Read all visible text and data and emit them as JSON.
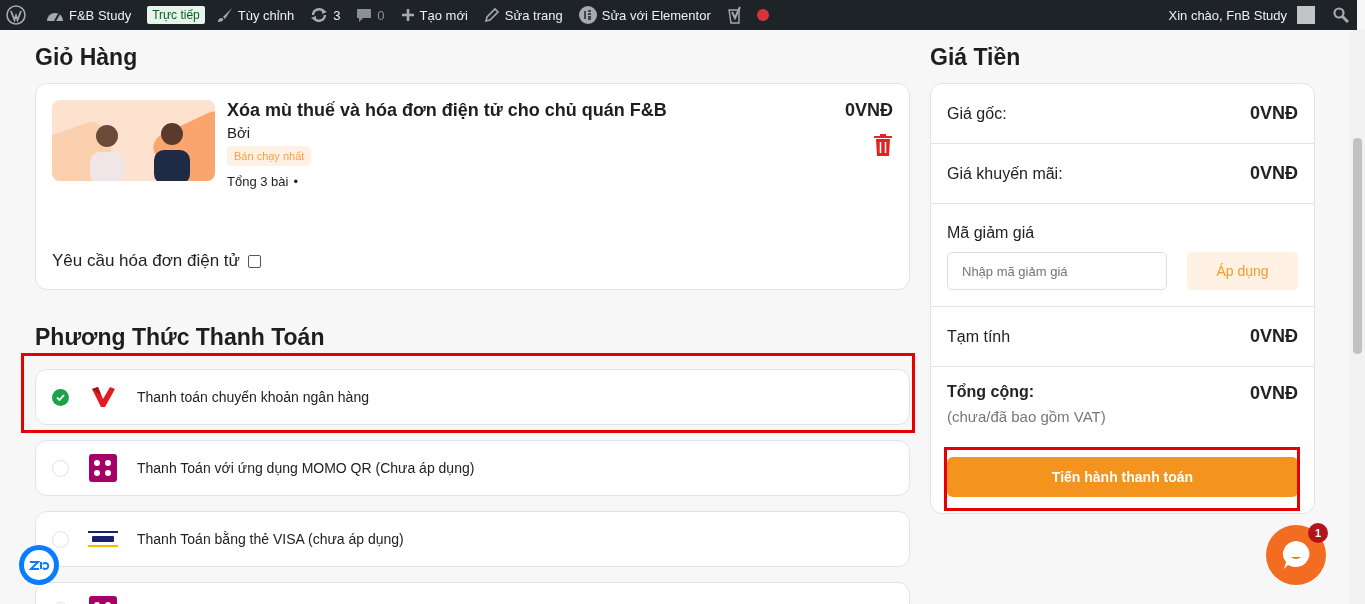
{
  "admin_bar": {
    "site": "F&B Study",
    "live_badge": "Trực tiếp",
    "customize": "Tùy chỉnh",
    "updates": "3",
    "comments": "0",
    "new": "Tạo mới",
    "edit_page": "Sửa trang",
    "elementor": "Sửa với Elementor",
    "greeting": "Xin chào, FnB Study"
  },
  "cart": {
    "title": "Giỏ Hàng",
    "items": [
      {
        "kind": "picture",
        "name": "Xóa mù thuế và hóa đơn điện tử cho chủ quán F&B",
        "by": "Bởi",
        "tag": "Bán chạy nhất",
        "lessons": "Tổng 3 bài",
        "bullet": "•",
        "price": "0VNĐ"
      }
    ],
    "invoice_label": "Yêu cầu hóa đơn điện tử",
    "invoice_checked": false
  },
  "payment": {
    "title": "Phương Thức Thanh Toán",
    "methods": [
      {
        "kind": "bank",
        "label": "Thanh toán chuyển khoản ngân hàng",
        "selected": true,
        "highlighted": true
      },
      {
        "kind": "momo",
        "label": "Thanh Toán với ứng dụng MOMO QR (Chưa áp dụng)",
        "selected": false,
        "highlighted": false
      },
      {
        "kind": "visa",
        "label": "Thanh Toán bằng thẻ VISA (chưa áp dụng)",
        "selected": false,
        "highlighted": false
      },
      {
        "kind": "momo",
        "selected": false,
        "highlighted": false
      }
    ]
  },
  "summary": {
    "title": "Giá Tiền",
    "rows": [
      {
        "kind": "line",
        "label": "Giá gốc:",
        "value": "0VNĐ"
      },
      {
        "kind": "line",
        "label": "Giá khuyến mãi:",
        "value": "0VNĐ"
      },
      {
        "kind": "coupon",
        "label": "Mã giảm giá",
        "placeholder": "Nhập mã giảm giá",
        "button": "Áp dụng"
      },
      {
        "kind": "line",
        "label": "Tạm tính",
        "value": "0VNĐ"
      },
      {
        "kind": "total",
        "label": "Tổng cộng:",
        "value": "0VNĐ",
        "note": "(chưa/đã bao gồm VAT)"
      }
    ],
    "checkout": {
      "label": "Tiến hành thanh toán",
      "highlighted": true
    }
  },
  "chat": {
    "badge": "1"
  }
}
